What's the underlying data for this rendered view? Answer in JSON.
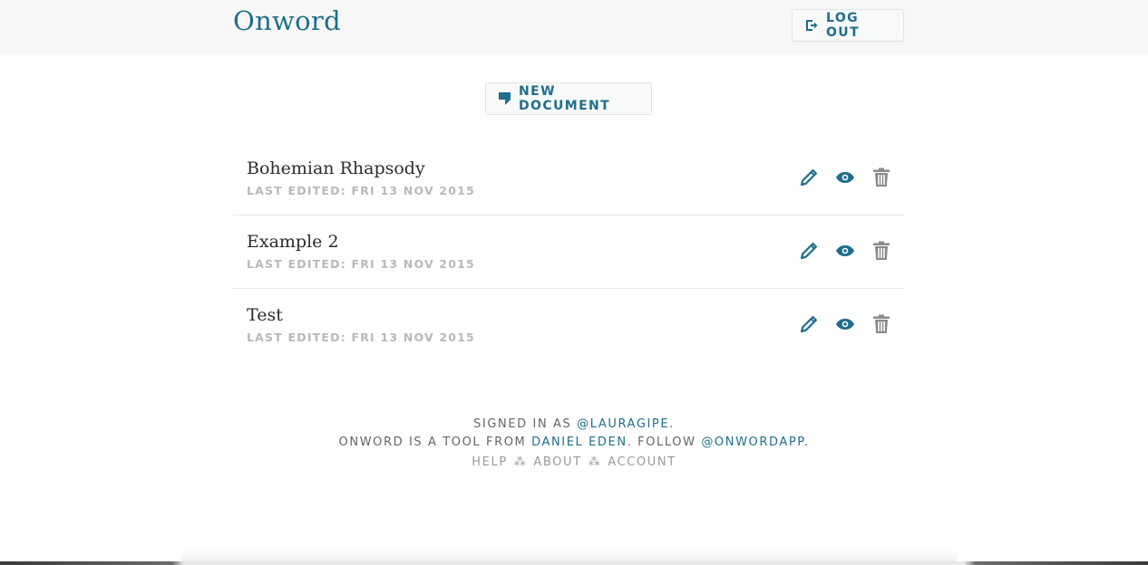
{
  "header": {
    "brand": "Onword",
    "logout_label": "Log out"
  },
  "toolbar": {
    "new_document_label": "New document"
  },
  "documents": [
    {
      "title": "Bohemian Rhapsody",
      "meta": "Last edited: Fri 13 Nov 2015"
    },
    {
      "title": "Example 2",
      "meta": "Last edited: Fri 13 Nov 2015"
    },
    {
      "title": "Test",
      "meta": "Last edited: Fri 13 Nov 2015"
    }
  ],
  "footer": {
    "signed_in_prefix": "Signed in as ",
    "username": "@lauragipe",
    "signed_in_suffix": ".",
    "tool_prefix": "Onword is a tool from ",
    "author": "Daniel Eden",
    "follow_text": ". Follow ",
    "twitter": "@onwordapp",
    "tool_suffix": ".",
    "help": "Help",
    "about": "About",
    "account": "Account",
    "separator": "⁂"
  },
  "colors": {
    "accent": "#1f6e8c",
    "muted": "#b9b9b9",
    "trash": "#8a8a8a"
  },
  "icons": {
    "logout": "logout-icon",
    "new_document": "document-icon",
    "edit": "pencil-icon",
    "view": "eye-icon",
    "delete": "trash-icon"
  }
}
